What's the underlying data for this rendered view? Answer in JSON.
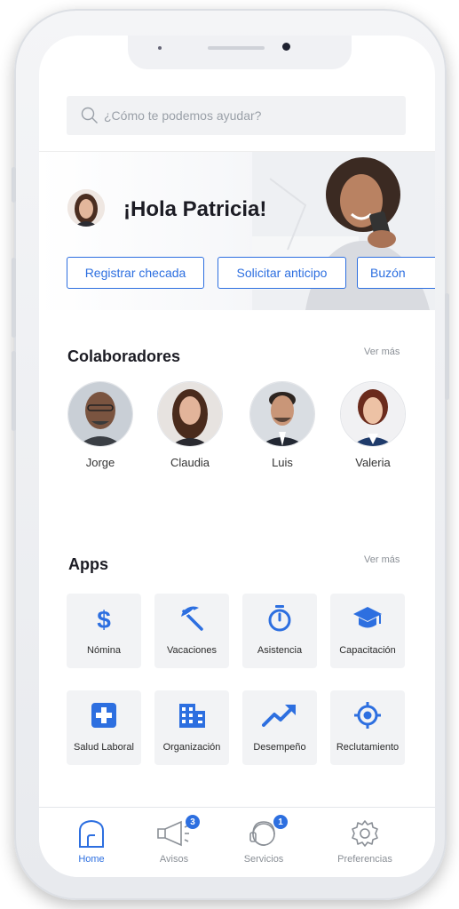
{
  "search": {
    "placeholder": "¿Cómo te podemos ayudar?"
  },
  "hero": {
    "greeting": "¡Hola Patricia!",
    "actions": [
      "Registrar checada",
      "Solicitar anticipo",
      "Buzón"
    ]
  },
  "collaborators": {
    "title": "Colaboradores",
    "more": "Ver más",
    "people": [
      "Jorge",
      "Claudia",
      "Luis",
      "Valeria"
    ]
  },
  "apps": {
    "title": "Apps",
    "more": "Ver más",
    "items": [
      {
        "label": "Nómina",
        "icon": "dollar-icon"
      },
      {
        "label": "Vacaciones",
        "icon": "beach-umbrella-icon"
      },
      {
        "label": "Asistencia",
        "icon": "stopwatch-icon"
      },
      {
        "label": "Capacitación",
        "icon": "graduation-cap-icon"
      },
      {
        "label": "Salud Laboral",
        "icon": "medical-cross-icon"
      },
      {
        "label": "Organización",
        "icon": "building-icon"
      },
      {
        "label": "Desempeño",
        "icon": "trending-up-icon"
      },
      {
        "label": "Reclutamiento",
        "icon": "target-icon"
      }
    ]
  },
  "tabs": [
    {
      "label": "Home",
      "icon": "home-icon",
      "active": true
    },
    {
      "label": "Avisos",
      "icon": "megaphone-icon",
      "badge": "3"
    },
    {
      "label": "Servicios",
      "icon": "headset-icon",
      "badge": "1"
    },
    {
      "label": "Preferencias",
      "icon": "gear-icon"
    }
  ],
  "colors": {
    "accent": "#2d6fe0",
    "tile": "#f2f3f5"
  }
}
